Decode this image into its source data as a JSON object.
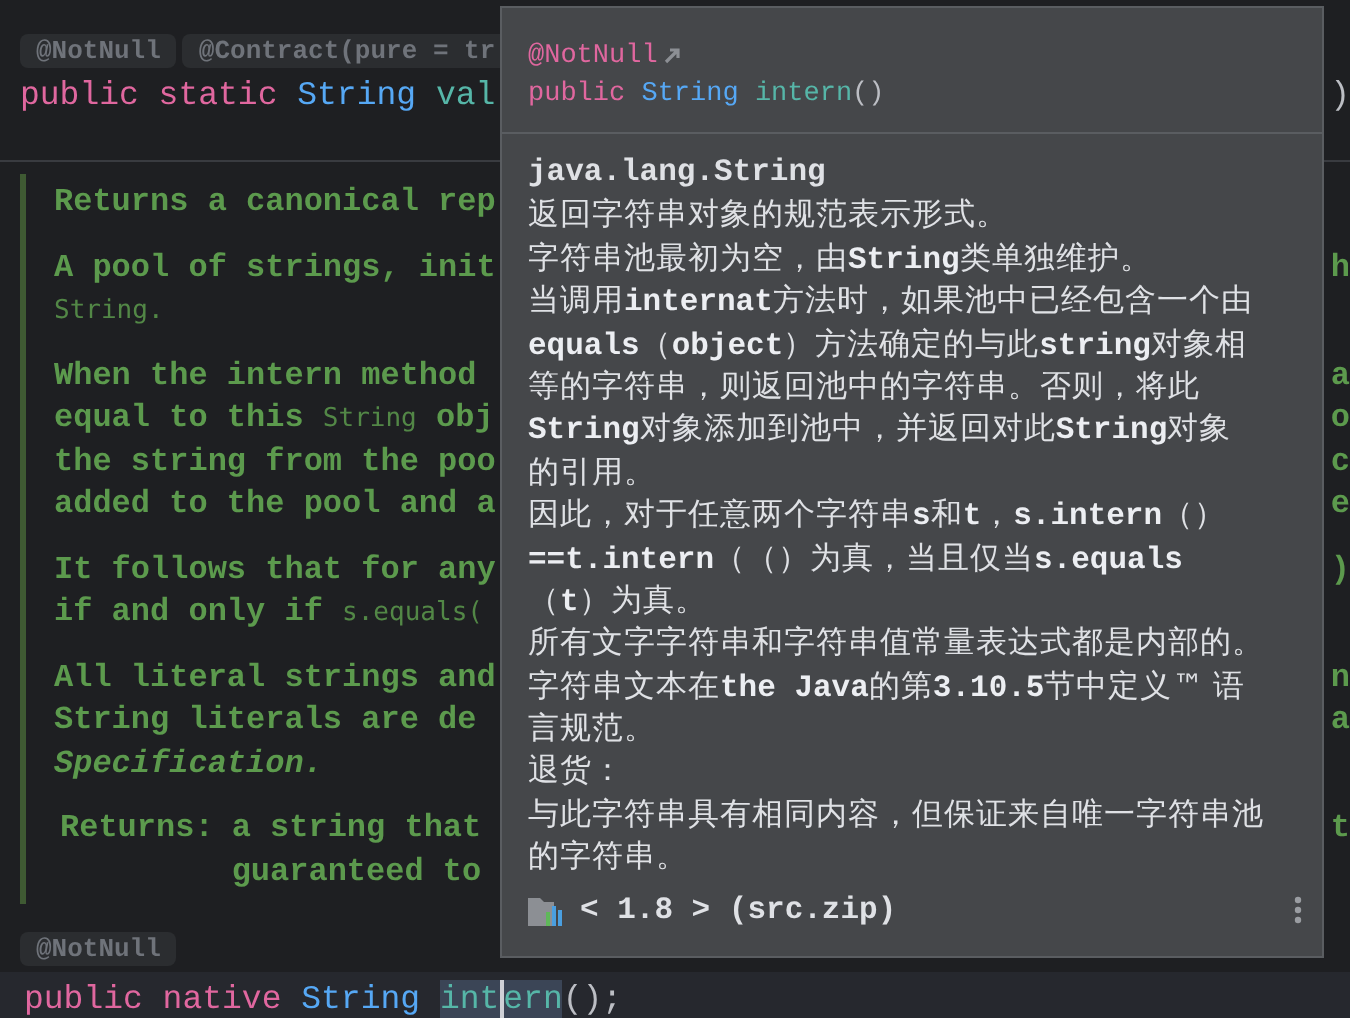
{
  "editor": {
    "top_annotations": [
      "@NotNull",
      "@Contract(pure = tr"
    ],
    "top_code": {
      "segments": [
        {
          "text": "public static ",
          "kind": "keyword"
        },
        {
          "text": "String ",
          "kind": "type"
        },
        {
          "text": "val",
          "kind": "ident"
        }
      ],
      "right": ")"
    },
    "doc": [
      {
        "lines": [
          {
            "segments": [
              {
                "text": "Returns a canonical rep",
                "kind": "text"
              }
            ]
          }
        ]
      },
      {
        "lines": [
          {
            "segments": [
              {
                "text": "A pool of strings, init",
                "kind": "text"
              }
            ],
            "right": "h"
          },
          {
            "segments": [
              {
                "text": "String.",
                "kind": "code"
              }
            ]
          }
        ]
      },
      {
        "lines": [
          {
            "segments": [
              {
                "text": "When the intern method",
                "kind": "text"
              }
            ],
            "right": "a"
          },
          {
            "segments": [
              {
                "text": "equal to this ",
                "kind": "text"
              },
              {
                "text": "String",
                "kind": "code"
              },
              {
                "text": " obj",
                "kind": "text"
              }
            ],
            "right": "o"
          },
          {
            "segments": [
              {
                "text": "the string from the poo",
                "kind": "text"
              }
            ],
            "right": "c"
          },
          {
            "segments": [
              {
                "text": "added to the pool and a",
                "kind": "text"
              }
            ],
            "right": "e"
          }
        ]
      },
      {
        "lines": [
          {
            "segments": [
              {
                "text": "It follows that for any",
                "kind": "text"
              }
            ],
            "right": ")"
          },
          {
            "segments": [
              {
                "text": "if and only if ",
                "kind": "text"
              },
              {
                "text": "s.equals(",
                "kind": "code"
              }
            ]
          }
        ]
      },
      {
        "lines": [
          {
            "segments": [
              {
                "text": "All literal strings and",
                "kind": "text"
              }
            ],
            "right": "n"
          },
          {
            "segments": [
              {
                "text": "String literals are de",
                "kind": "text"
              }
            ],
            "right": "a"
          },
          {
            "segments": [
              {
                "text": "Specification.",
                "kind": "italic"
              }
            ]
          }
        ]
      }
    ],
    "returns": {
      "label": "Returns:",
      "lines": [
        "a string that",
        "guaranteed to"
      ],
      "right": "t"
    },
    "bottom_annotation": "@NotNull",
    "bottom_code": {
      "segments": [
        {
          "text": "public native ",
          "kind": "keyword"
        },
        {
          "text": "String ",
          "kind": "type"
        },
        {
          "text": "int",
          "kind": "ident",
          "highlighted": true
        },
        {
          "text": "ern",
          "kind": "ident",
          "highlighted": true,
          "caret_before": true
        },
        {
          "text": "();",
          "kind": "plain"
        }
      ]
    }
  },
  "popup": {
    "annotation": "@NotNull",
    "signature": [
      {
        "text": "public ",
        "kind": "keyword"
      },
      {
        "text": "String ",
        "kind": "type"
      },
      {
        "text": "intern",
        "kind": "ident"
      },
      {
        "text": "()",
        "kind": "plain"
      }
    ],
    "class_name": "java.lang.String",
    "body": [
      "返回字符串对象的规范表示形式。",
      "字符串池最初为空，由**String**类单独维护。",
      "当调用**internat**方法时，如果池中已经包含一个由",
      "**equals**（**object**）方法确定的与此**string**对象相",
      "等的字符串，则返回池中的字符串。否则，将此",
      "**String**对象添加到池中，并返回对此**String**对象",
      "的引用。",
      "因此，对于任意两个字符串**s**和**t**，**s.intern**（）",
      "**==t.intern**（（）为真，当且仅当**s.equals**",
      "（**t**）为真。",
      "所有文字字符串和字符串值常量表达式都是内部的。",
      "字符串文本在**the Java**的第**3.10.5**节中定义™ 语",
      "言规范。",
      "退货：",
      "与此字符串具有相同内容，但保证来自唯一字符串池",
      "的字符串。"
    ],
    "source": "< 1.8 > (src.zip)"
  }
}
